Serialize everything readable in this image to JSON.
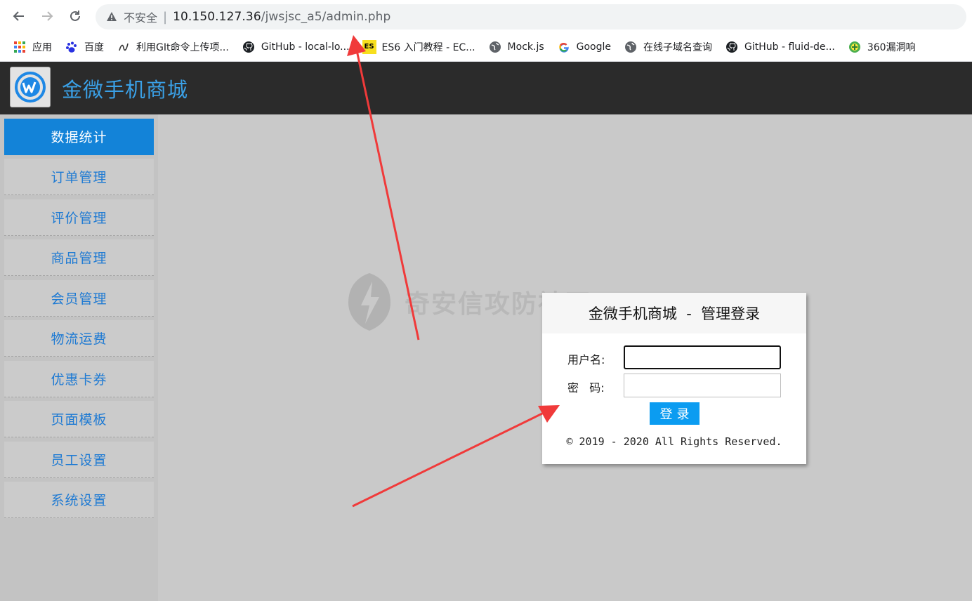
{
  "browser": {
    "not_secure": "不安全",
    "url_host": "10.150.127.36",
    "url_path": "/jwsjsc_a5/admin.php",
    "bookmarks": [
      {
        "label": "应用",
        "icon": "apps-grid-icon"
      },
      {
        "label": "百度",
        "icon": "baidu-paw-icon"
      },
      {
        "label": "利用GIt命令上传项...",
        "icon": "script-icon"
      },
      {
        "label": "GitHub - local-lo...",
        "icon": "github-icon"
      },
      {
        "label": "ES6 入门教程 - EC...",
        "icon": "es-badge-icon"
      },
      {
        "label": "Mock.js",
        "icon": "globe-icon"
      },
      {
        "label": "Google",
        "icon": "google-g-icon"
      },
      {
        "label": "在线子域名查询",
        "icon": "globe-icon"
      },
      {
        "label": "GitHub - fluid-de...",
        "icon": "github-icon"
      },
      {
        "label": "360漏洞响",
        "icon": "360-icon"
      }
    ]
  },
  "header": {
    "title": "金微手机商城"
  },
  "sidebar": {
    "items": [
      {
        "label": "数据统计"
      },
      {
        "label": "订单管理"
      },
      {
        "label": "评价管理"
      },
      {
        "label": "商品管理"
      },
      {
        "label": "会员管理"
      },
      {
        "label": "物流运费"
      },
      {
        "label": "优惠卡券"
      },
      {
        "label": "页面模板"
      },
      {
        "label": "员工设置"
      },
      {
        "label": "系统设置"
      }
    ]
  },
  "watermark": {
    "text": "奇安信攻防社区"
  },
  "login": {
    "title": "金微手机商城  -  管理登录",
    "username_label": "用户名:",
    "username_value": "",
    "password_label": "密   码:",
    "password_value": "",
    "submit_label": "登录",
    "copyright": "© 2019 - 2020 All Rights Reserved."
  },
  "colors": {
    "accent": "#1383d8",
    "header_bg": "#2b2b2b",
    "title_blue": "#3aa0e6",
    "button_blue": "#0b9cf1",
    "arrow_red": "#f03a3a"
  }
}
